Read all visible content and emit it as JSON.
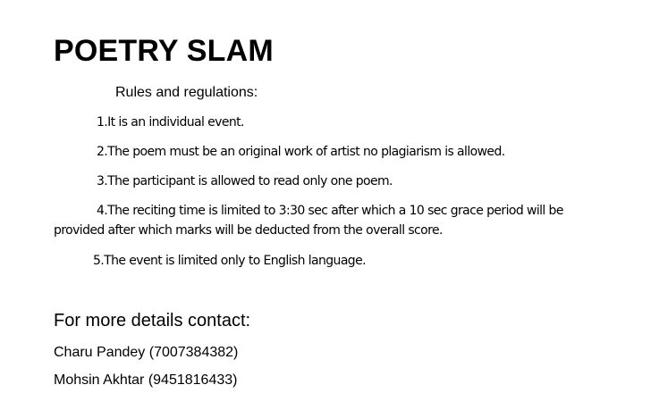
{
  "document": {
    "title": "POETRY SLAM",
    "subtitle": "Rules and regulations:",
    "rules": [
      "1.It is an individual event.",
      "2.The poem must be an original work of artist no plagiarism is allowed.",
      "3.The participant is allowed to read only one poem.",
      "4.The reciting time is limited to 3:30 sec after which a 10 sec grace period will be provided after which marks will be deducted from the overall score.",
      "5.The event is limited only to English language."
    ],
    "contact_heading": "For more details contact:",
    "contacts": [
      "Charu Pandey (7007384382)",
      "Mohsin Akhtar (9451816433)"
    ]
  }
}
